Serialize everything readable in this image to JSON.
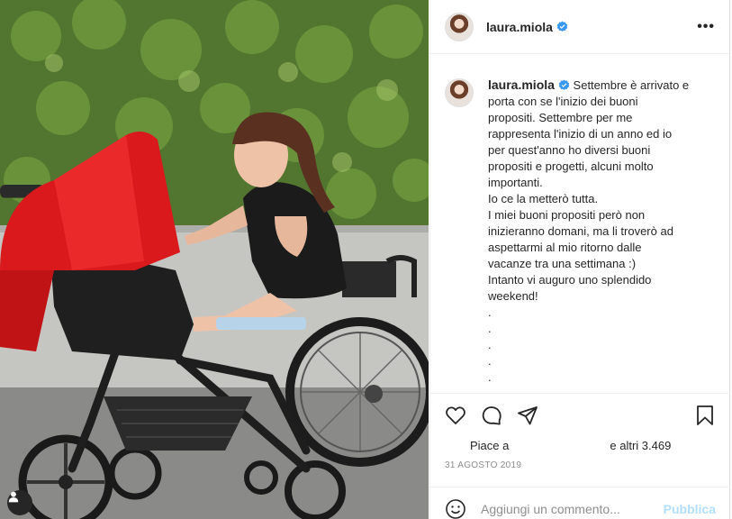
{
  "post": {
    "username": "laura.miola",
    "verified": true,
    "caption_lines": [
      "Settembre è arrivato e",
      "porta con se l'inizio dei buoni",
      "propositi. Settembre per me",
      "rappresenta l'inizio di un anno ed io",
      "per quest'anno ho diversi buoni",
      "propositi e progetti, alcuni molto",
      "importanti.",
      "Io ce la metterò tutta.",
      "I miei buoni propositi però non",
      "inizieranno domani, ma li troverò ad",
      "aspettarmi al mio ritorno dalle",
      "vacanze tra una settimana :)",
      "Intanto vi auguro uno splendido",
      "weekend!",
      ".",
      ".",
      ".",
      ".",
      "."
    ]
  },
  "header": {
    "more_label": "•••"
  },
  "likes": {
    "prefix": "Piace a",
    "suffix": "e altri 3.469"
  },
  "date": "31 AGOSTO 2019",
  "comment": {
    "placeholder": "Aggiungi un commento...",
    "publish_label": "Pubblica"
  },
  "colors": {
    "verified_blue": "#3897f0",
    "publish_blue": "#b2dffc",
    "text": "#262626",
    "muted": "#8e8e8e"
  },
  "icons": {
    "like": "heart-icon",
    "comment": "comment-icon",
    "share": "send-icon",
    "save": "bookmark-icon",
    "emoji": "emoji-icon",
    "tag": "user-tag-icon"
  }
}
